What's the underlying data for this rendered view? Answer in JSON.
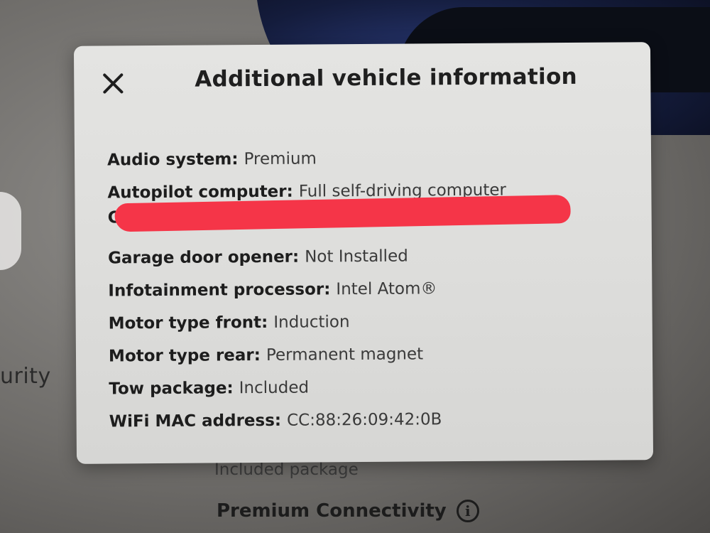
{
  "background": {
    "security_text": "urity",
    "included_package_text": "Included package",
    "premium_connectivity_label": "Premium Connectivity",
    "info_icon_glyph": "i"
  },
  "modal": {
    "title": "Additional vehicle information",
    "close_glyph": "×",
    "redacted_row_peek": "C",
    "rows": [
      {
        "label": "Audio system:",
        "value": "Premium"
      },
      {
        "label": "Autopilot computer:",
        "value": "Full self-driving computer"
      },
      {
        "label": "",
        "value": ""
      },
      {
        "label": "Garage door opener:",
        "value": "Not Installed"
      },
      {
        "label": "Infotainment processor:",
        "value": "Intel Atom®"
      },
      {
        "label": "Motor type front:",
        "value": "Induction"
      },
      {
        "label": "Motor type rear:",
        "value": "Permanent magnet"
      },
      {
        "label": "Tow package:",
        "value": "Included"
      },
      {
        "label": "WiFi MAC address:",
        "value": "CC:88:26:09:42:0B"
      }
    ]
  },
  "colors": {
    "redaction": "#f53548",
    "modal_bg": "#e0e0de",
    "car_accent": "#2a3a78"
  }
}
